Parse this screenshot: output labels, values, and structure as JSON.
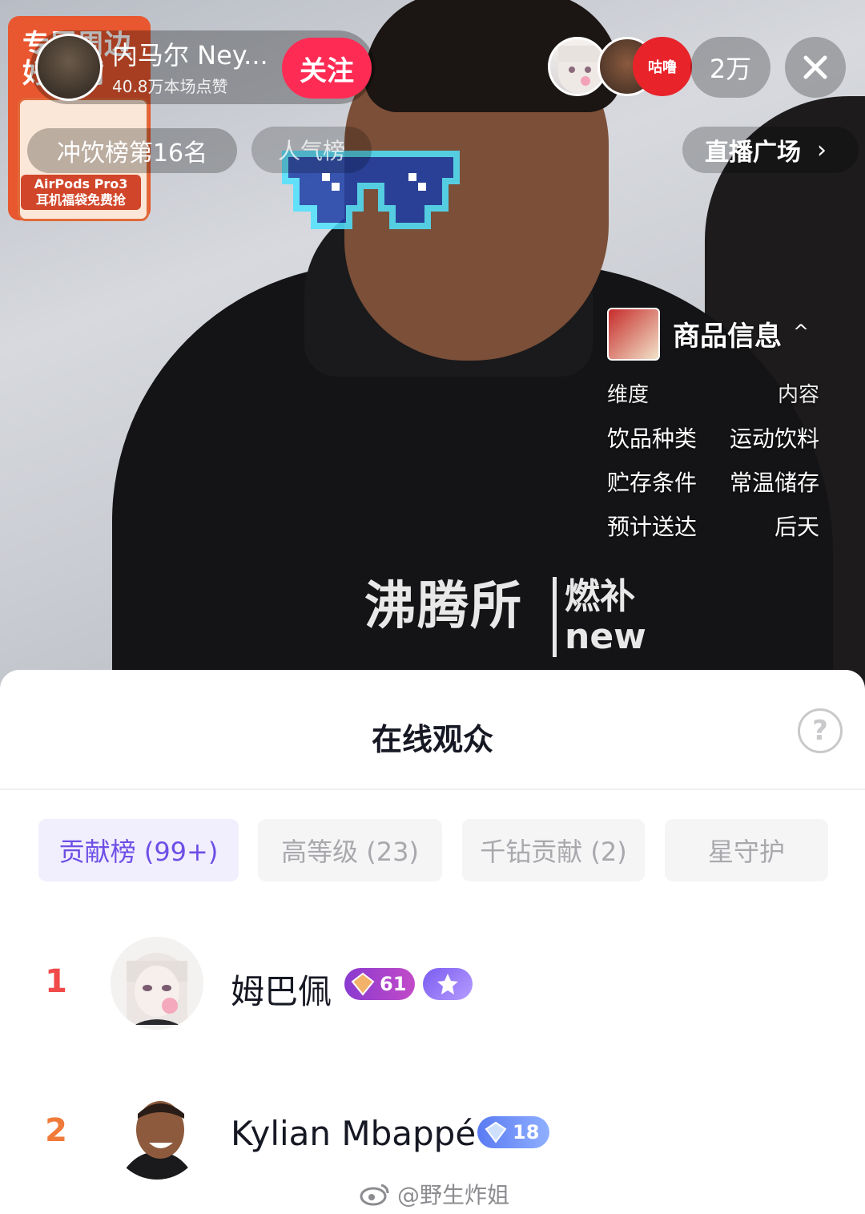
{
  "stream": {
    "promo_title": "专属周边",
    "promo_line2": "好礼嘴",
    "promo_text_1": "AirPods Pro3",
    "promo_text_2": "耳机福袋免费抢",
    "streamer_name": "内马尔 Ney...",
    "likes": "40.8万本场点赞",
    "follow_label": "关注",
    "viewer_count": "2万",
    "rank_label": "冲饮榜第16名",
    "popularity_label": "人气榜",
    "plaza_label": "直播广场",
    "shirt_main": "沸腾所",
    "shirt_sub_1": "燃补",
    "shirt_sub_2": "new",
    "product": {
      "title": "商品信息",
      "caret": "^",
      "header": {
        "left": "维度",
        "right": "内容"
      },
      "rows": [
        {
          "key": "饮品种类",
          "value": "运动饮料"
        },
        {
          "key": "贮存条件",
          "value": "常温储存"
        },
        {
          "key": "预计送达",
          "value": "后天"
        }
      ]
    }
  },
  "sheet": {
    "title": "在线观众",
    "help": "?",
    "tabs": [
      {
        "label": "贡献榜 (99+)",
        "active": true
      },
      {
        "label": "高等级 (23)",
        "active": false
      },
      {
        "label": "千钻贡献 (2)",
        "active": false
      },
      {
        "label": "星守护",
        "active": false
      }
    ],
    "viewers": [
      {
        "rank": "1",
        "name": "姆巴佩",
        "level": "61"
      },
      {
        "rank": "2",
        "name": "Kylian Mbappé",
        "level": "18"
      }
    ]
  },
  "watermark": "@野生炸姐",
  "colors": {
    "accent_pink": "#fe2c55",
    "rank_red": "#f04a4a",
    "rank_orange": "#f07a3a",
    "tab_active": "#6d4fe6"
  }
}
